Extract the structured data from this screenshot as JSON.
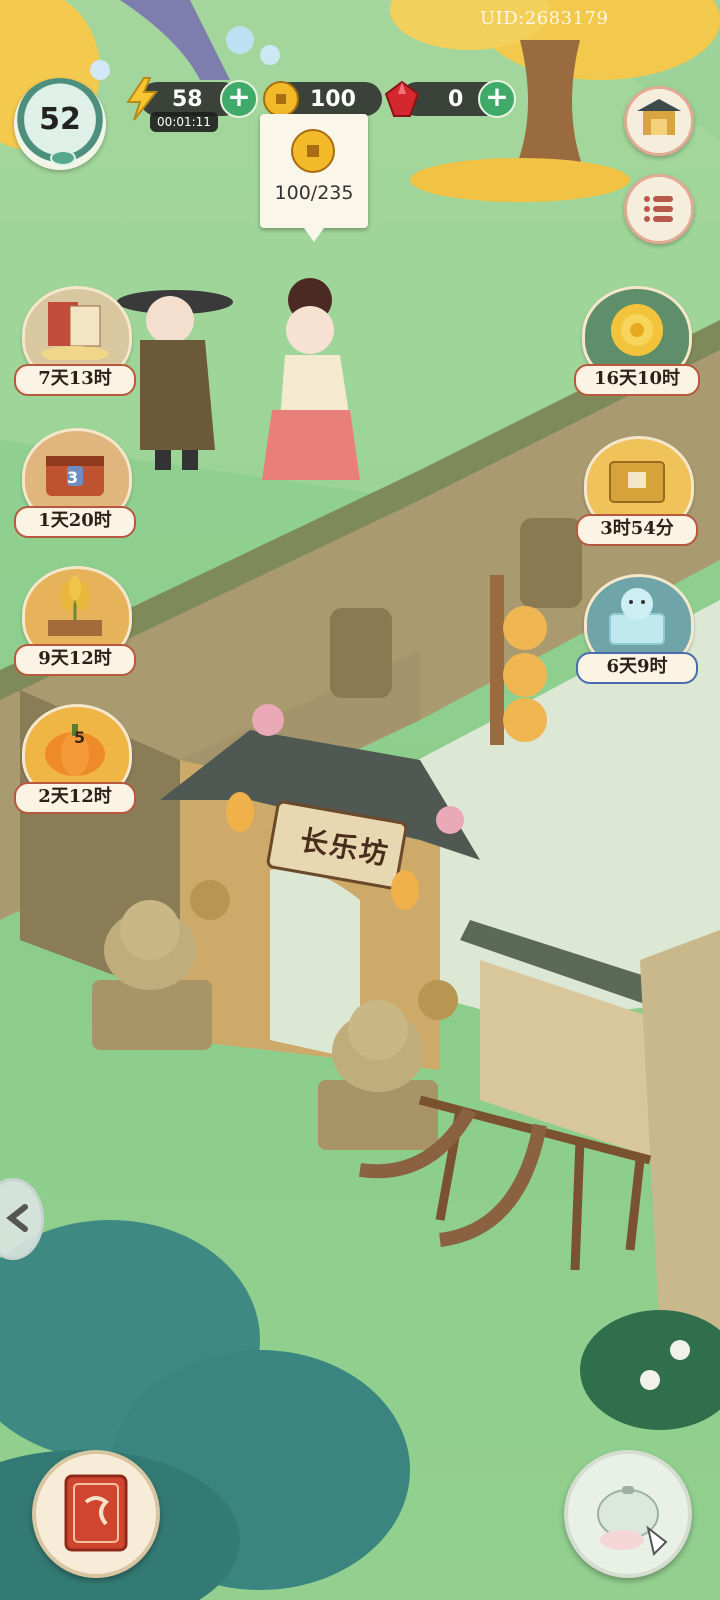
{
  "hud": {
    "uid": "UID:2683179",
    "level": "52",
    "energy": {
      "value": "58",
      "timer": "00:01:11"
    },
    "coins": {
      "value": "100",
      "tooltip": "100/235"
    },
    "gems": {
      "value": "0"
    }
  },
  "scene": {
    "gate_sign": "长乐坊"
  },
  "left_events": [
    {
      "id": "scrolls",
      "time": "7天13时"
    },
    {
      "id": "chest",
      "time": "1天20时",
      "count": "3"
    },
    {
      "id": "wheat",
      "time": "9天12时"
    },
    {
      "id": "pumpkin",
      "time": "2天12时",
      "count": "5"
    }
  ],
  "right_events": [
    {
      "id": "chrysanthemum",
      "time": "16天10时"
    },
    {
      "id": "mooncake-box",
      "time": "3时54分"
    },
    {
      "id": "gift-cat",
      "time": "6天9时"
    }
  ],
  "colors": {
    "grass": "#8fcf8f",
    "badge_border": "#b8583f",
    "plus_green": "#3faa6a",
    "gem_red": "#d3282e"
  },
  "icons": {
    "energy": "lightning-icon",
    "coin": "coin-icon",
    "gem": "gem-icon",
    "menu": "list-icon",
    "shop": "shop-icon",
    "book": "book-icon",
    "tea": "teapot-icon",
    "back": "back-arrow-icon"
  }
}
